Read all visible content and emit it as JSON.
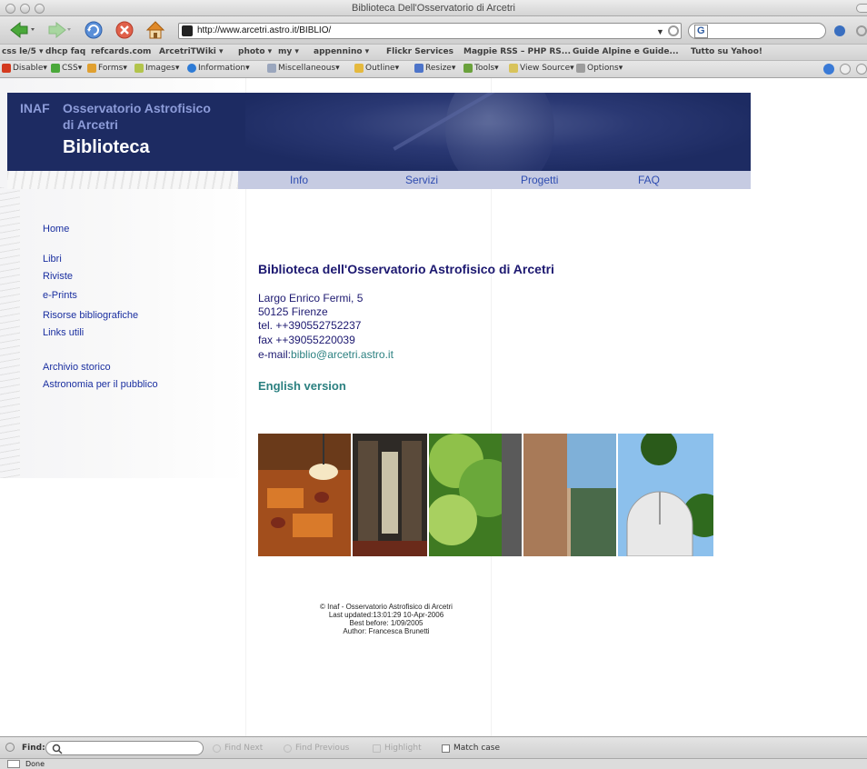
{
  "window": {
    "title": "Biblioteca Dell'Osservatorio di Arcetri"
  },
  "navbar": {
    "url": "http://www.arcetri.astro.it/BIBLIO/",
    "search_engine_glyph": "G"
  },
  "bookmarks": [
    "css le/5 ▾",
    "dhcp faq",
    "refcards.com",
    "ArcetriTWiki ▾",
    "photo ▾",
    "my ▾",
    "appennino ▾",
    "Flickr Services",
    "Magpie RSS – PHP RS...",
    "Guide Alpine e Guide...",
    "Tutto su Yahoo!"
  ],
  "devbar": [
    {
      "label": "Disable",
      "color": "#d33a1f"
    },
    {
      "label": "CSS",
      "color": "#4aa83a"
    },
    {
      "label": "Forms",
      "color": "#e0a030"
    },
    {
      "label": "Images",
      "color": "#b2c44c"
    },
    {
      "label": "Information",
      "color": "#2d7bd6"
    },
    {
      "label": "Miscellaneous",
      "color": "#9aa6bd"
    },
    {
      "label": "Outline",
      "color": "#e5b93e"
    },
    {
      "label": "Resize",
      "color": "#4d74c9"
    },
    {
      "label": "Tools",
      "color": "#6aa13c"
    },
    {
      "label": "View Source",
      "color": "#d8c35b"
    },
    {
      "label": "Options",
      "color": "#9c9c9c"
    }
  ],
  "banner": {
    "inaf": "INAF",
    "observatory_line1": "Osservatorio Astrofisico",
    "observatory_line2": "di Arcetri",
    "library": "Biblioteca"
  },
  "menu": [
    "Info",
    "Servizi",
    "Progetti",
    "FAQ"
  ],
  "sidenav": [
    "Home",
    "Libri",
    "Riviste",
    "e-Prints",
    "Risorse bibliografiche",
    "Links utili",
    "Archivio storico",
    "Astronomia per il pubblico"
  ],
  "content": {
    "title": "Biblioteca dell'Osservatorio Astrofisico di Arcetri",
    "address": "Largo Enrico Fermi, 5",
    "city": "50125 Firenze",
    "tel": "tel. ++390552752237",
    "fax": "fax ++39055220039",
    "email_label": "e-mail:",
    "email": "biblio@arcetri.astro.it",
    "english_link": "English version"
  },
  "footer": [
    "© Inaf - Osservatorio Astrofisico di Arcetri",
    "Last updated:13:01:29 10-Apr-2006",
    "Best before: 1/09/2005",
    "Author: Francesca Brunetti"
  ],
  "findbar": {
    "label": "Find:",
    "find_next": "Find Next",
    "find_previous": "Find Previous",
    "highlight": "Highlight",
    "match_case": "Match case"
  },
  "status": {
    "text": "Done"
  },
  "colors": {
    "banner_bg": "#1d2b62",
    "banner_subtitle": "#8d9cd9",
    "menubar_bg": "#c6cbe2",
    "link_blue": "#1a2fa0",
    "heading_navy": "#1c1870",
    "teal_link": "#2b8080"
  }
}
